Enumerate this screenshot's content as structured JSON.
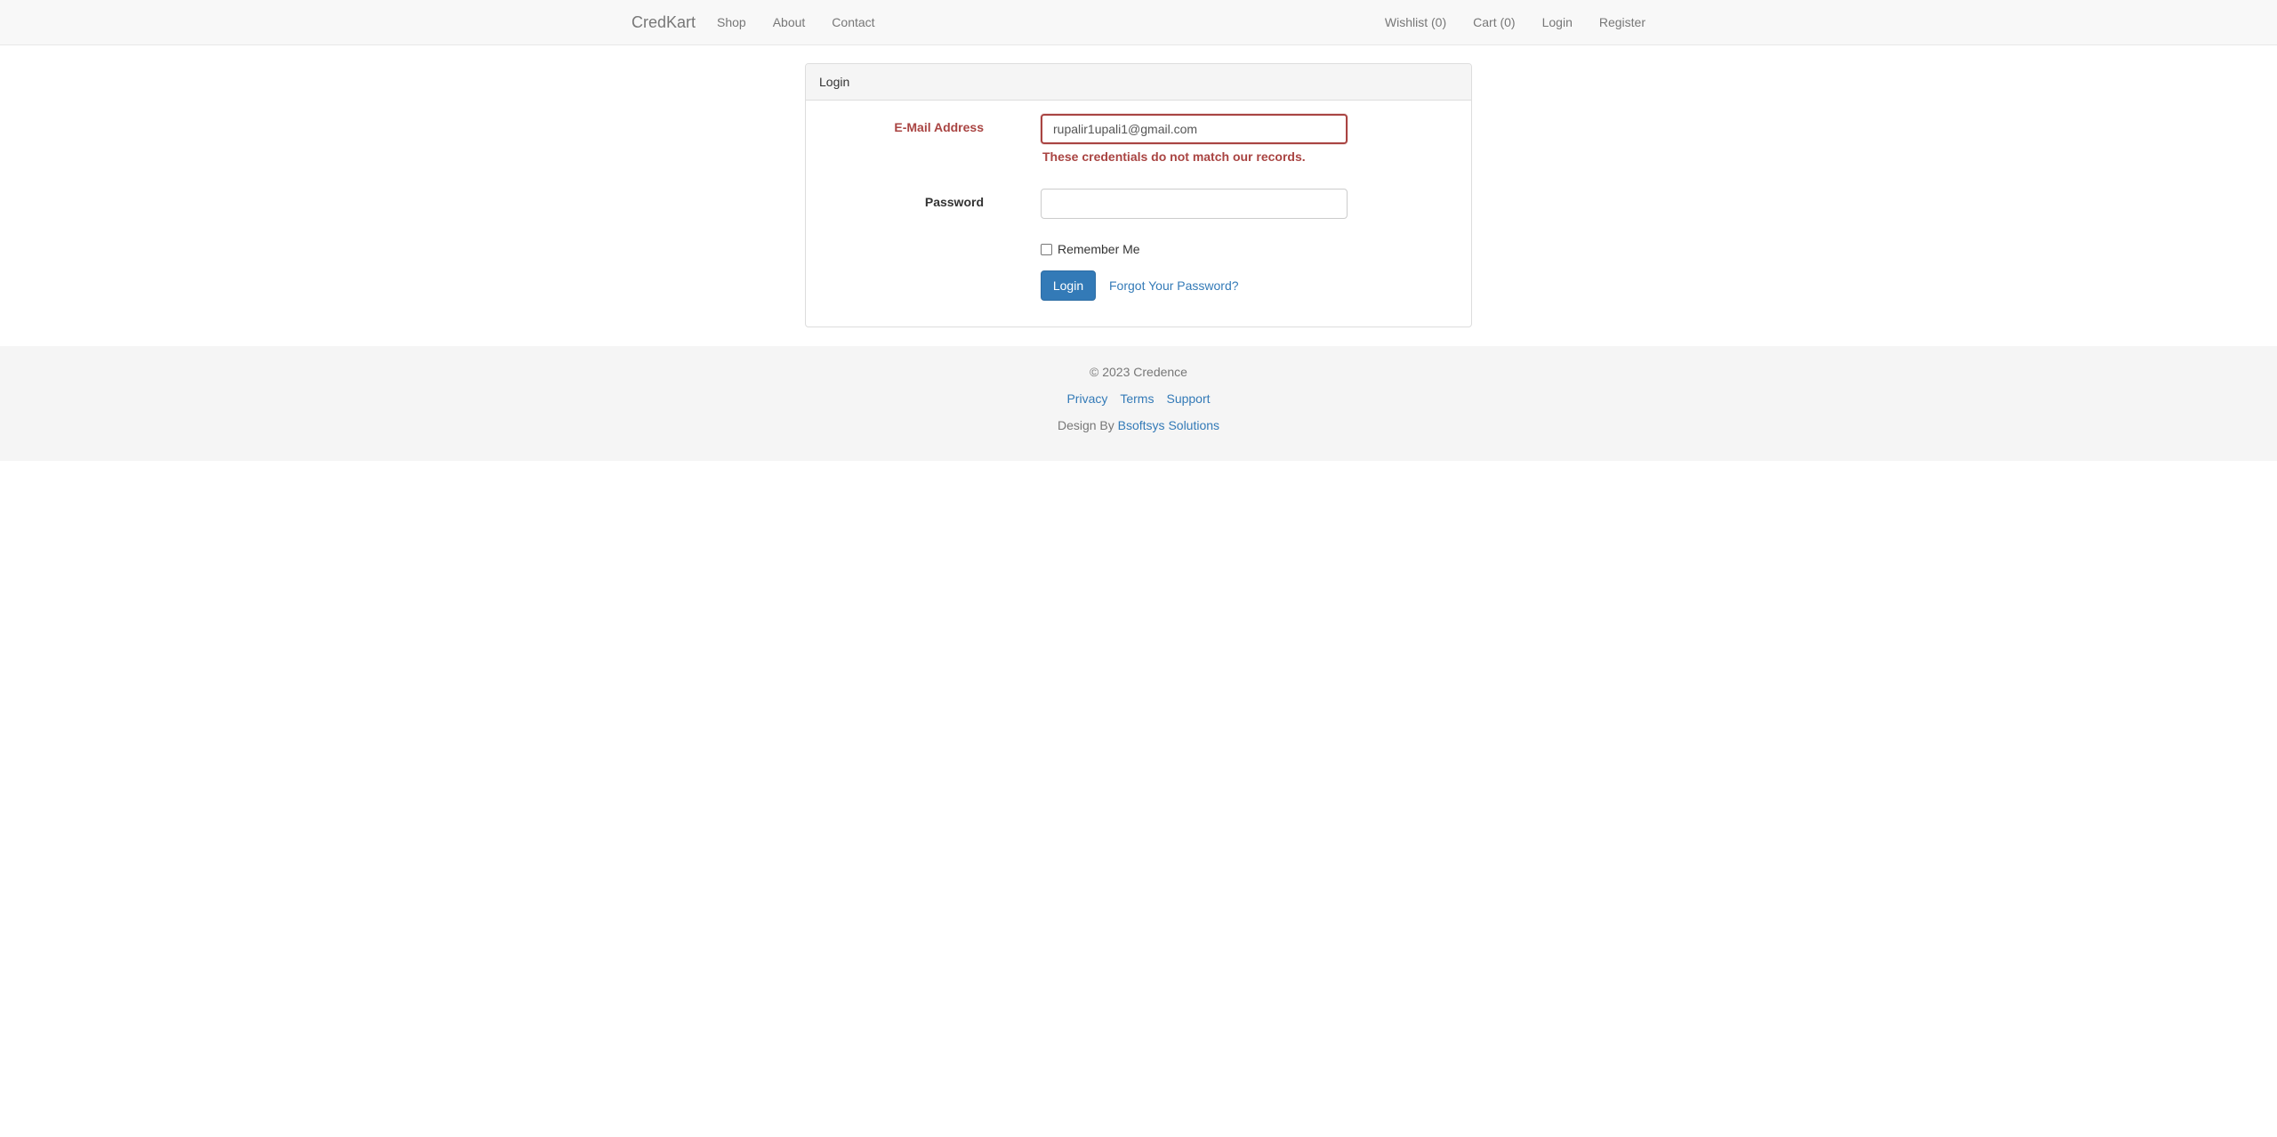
{
  "navbar": {
    "brand": "CredKart",
    "left_links": [
      "Shop",
      "About",
      "Contact"
    ],
    "right_links": [
      "Wishlist (0)",
      "Cart (0)",
      "Login",
      "Register"
    ]
  },
  "login_panel": {
    "heading": "Login",
    "email": {
      "label": "E-Mail Address",
      "value": "rupalir1upali1@gmail.com",
      "error": "These credentials do not match our records."
    },
    "password": {
      "label": "Password",
      "value": ""
    },
    "remember_me": {
      "label": "Remember Me",
      "checked": false
    },
    "submit_label": "Login",
    "forgot_label": "Forgot Your Password?"
  },
  "footer": {
    "copyright": "© 2023 Credence",
    "links": [
      "Privacy",
      "Terms",
      "Support"
    ],
    "design_by_prefix": "Design By",
    "design_by_link": "Bsoftsys Solutions"
  },
  "colors": {
    "primary": "#337ab7",
    "error": "#a94442",
    "navbar_bg": "#f8f8f8",
    "footer_bg": "#f5f5f5"
  }
}
